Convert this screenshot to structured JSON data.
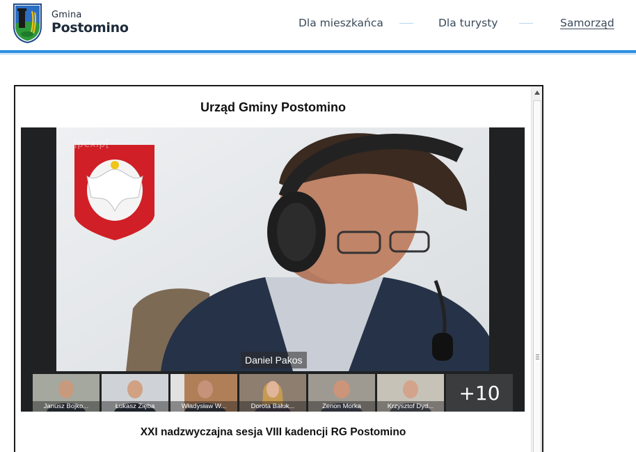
{
  "header": {
    "brand_small": "Gmina",
    "brand_big": "Postomino",
    "nav": [
      {
        "label": "Dla mieszkańca"
      },
      {
        "label": "Dla turysty"
      },
      {
        "label": "Samorząd",
        "active": true
      }
    ],
    "accent": "#2f8fe0"
  },
  "embed": {
    "title": "Urząd Gminy Postomino",
    "watermark": "]pexip[",
    "speaker": "Daniel Pakos",
    "participants": [
      {
        "name": "Janusz Bojko..."
      },
      {
        "name": "Łukasz Zięba"
      },
      {
        "name": "Władysław W..."
      },
      {
        "name": "Dorota Bałuk..."
      },
      {
        "name": "Zenon Morka"
      },
      {
        "name": "Krzysztof Dyd..."
      }
    ],
    "more_count": "+10",
    "caption": "XXI nadzwyczajna sesja VIII kadencji RG Postomino"
  },
  "icons": {
    "logo": "gmina-coat-of-arms-icon",
    "scroll_up": "triangle-up-icon",
    "scroll_grip": "grip-lines-icon"
  }
}
